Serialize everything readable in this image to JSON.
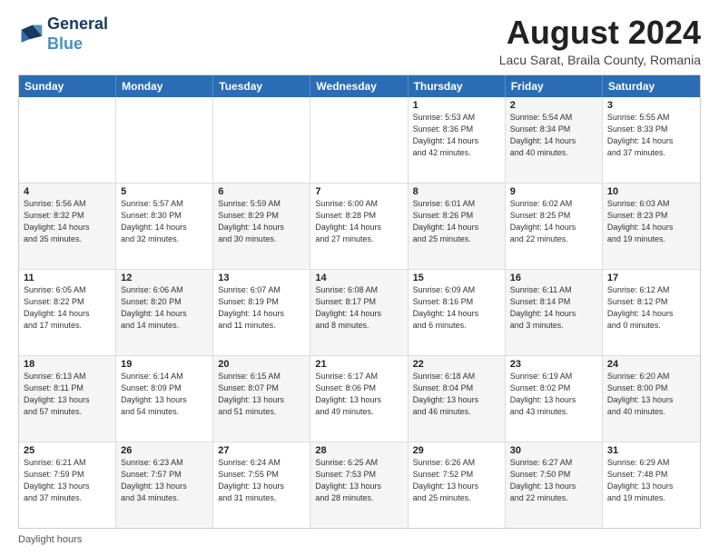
{
  "header": {
    "logo_line1": "General",
    "logo_line2": "Blue",
    "main_title": "August 2024",
    "subtitle": "Lacu Sarat, Braila County, Romania"
  },
  "days_of_week": [
    "Sunday",
    "Monday",
    "Tuesday",
    "Wednesday",
    "Thursday",
    "Friday",
    "Saturday"
  ],
  "footer_text": "Daylight hours",
  "weeks": [
    [
      {
        "day": "",
        "shaded": false,
        "info": ""
      },
      {
        "day": "",
        "shaded": false,
        "info": ""
      },
      {
        "day": "",
        "shaded": false,
        "info": ""
      },
      {
        "day": "",
        "shaded": false,
        "info": ""
      },
      {
        "day": "1",
        "shaded": false,
        "info": "Sunrise: 5:53 AM\nSunset: 8:36 PM\nDaylight: 14 hours\nand 42 minutes."
      },
      {
        "day": "2",
        "shaded": true,
        "info": "Sunrise: 5:54 AM\nSunset: 8:34 PM\nDaylight: 14 hours\nand 40 minutes."
      },
      {
        "day": "3",
        "shaded": false,
        "info": "Sunrise: 5:55 AM\nSunset: 8:33 PM\nDaylight: 14 hours\nand 37 minutes."
      }
    ],
    [
      {
        "day": "4",
        "shaded": true,
        "info": "Sunrise: 5:56 AM\nSunset: 8:32 PM\nDaylight: 14 hours\nand 35 minutes."
      },
      {
        "day": "5",
        "shaded": false,
        "info": "Sunrise: 5:57 AM\nSunset: 8:30 PM\nDaylight: 14 hours\nand 32 minutes."
      },
      {
        "day": "6",
        "shaded": true,
        "info": "Sunrise: 5:59 AM\nSunset: 8:29 PM\nDaylight: 14 hours\nand 30 minutes."
      },
      {
        "day": "7",
        "shaded": false,
        "info": "Sunrise: 6:00 AM\nSunset: 8:28 PM\nDaylight: 14 hours\nand 27 minutes."
      },
      {
        "day": "8",
        "shaded": true,
        "info": "Sunrise: 6:01 AM\nSunset: 8:26 PM\nDaylight: 14 hours\nand 25 minutes."
      },
      {
        "day": "9",
        "shaded": false,
        "info": "Sunrise: 6:02 AM\nSunset: 8:25 PM\nDaylight: 14 hours\nand 22 minutes."
      },
      {
        "day": "10",
        "shaded": true,
        "info": "Sunrise: 6:03 AM\nSunset: 8:23 PM\nDaylight: 14 hours\nand 19 minutes."
      }
    ],
    [
      {
        "day": "11",
        "shaded": false,
        "info": "Sunrise: 6:05 AM\nSunset: 8:22 PM\nDaylight: 14 hours\nand 17 minutes."
      },
      {
        "day": "12",
        "shaded": true,
        "info": "Sunrise: 6:06 AM\nSunset: 8:20 PM\nDaylight: 14 hours\nand 14 minutes."
      },
      {
        "day": "13",
        "shaded": false,
        "info": "Sunrise: 6:07 AM\nSunset: 8:19 PM\nDaylight: 14 hours\nand 11 minutes."
      },
      {
        "day": "14",
        "shaded": true,
        "info": "Sunrise: 6:08 AM\nSunset: 8:17 PM\nDaylight: 14 hours\nand 8 minutes."
      },
      {
        "day": "15",
        "shaded": false,
        "info": "Sunrise: 6:09 AM\nSunset: 8:16 PM\nDaylight: 14 hours\nand 6 minutes."
      },
      {
        "day": "16",
        "shaded": true,
        "info": "Sunrise: 6:11 AM\nSunset: 8:14 PM\nDaylight: 14 hours\nand 3 minutes."
      },
      {
        "day": "17",
        "shaded": false,
        "info": "Sunrise: 6:12 AM\nSunset: 8:12 PM\nDaylight: 14 hours\nand 0 minutes."
      }
    ],
    [
      {
        "day": "18",
        "shaded": true,
        "info": "Sunrise: 6:13 AM\nSunset: 8:11 PM\nDaylight: 13 hours\nand 57 minutes."
      },
      {
        "day": "19",
        "shaded": false,
        "info": "Sunrise: 6:14 AM\nSunset: 8:09 PM\nDaylight: 13 hours\nand 54 minutes."
      },
      {
        "day": "20",
        "shaded": true,
        "info": "Sunrise: 6:15 AM\nSunset: 8:07 PM\nDaylight: 13 hours\nand 51 minutes."
      },
      {
        "day": "21",
        "shaded": false,
        "info": "Sunrise: 6:17 AM\nSunset: 8:06 PM\nDaylight: 13 hours\nand 49 minutes."
      },
      {
        "day": "22",
        "shaded": true,
        "info": "Sunrise: 6:18 AM\nSunset: 8:04 PM\nDaylight: 13 hours\nand 46 minutes."
      },
      {
        "day": "23",
        "shaded": false,
        "info": "Sunrise: 6:19 AM\nSunset: 8:02 PM\nDaylight: 13 hours\nand 43 minutes."
      },
      {
        "day": "24",
        "shaded": true,
        "info": "Sunrise: 6:20 AM\nSunset: 8:00 PM\nDaylight: 13 hours\nand 40 minutes."
      }
    ],
    [
      {
        "day": "25",
        "shaded": false,
        "info": "Sunrise: 6:21 AM\nSunset: 7:59 PM\nDaylight: 13 hours\nand 37 minutes."
      },
      {
        "day": "26",
        "shaded": true,
        "info": "Sunrise: 6:23 AM\nSunset: 7:57 PM\nDaylight: 13 hours\nand 34 minutes."
      },
      {
        "day": "27",
        "shaded": false,
        "info": "Sunrise: 6:24 AM\nSunset: 7:55 PM\nDaylight: 13 hours\nand 31 minutes."
      },
      {
        "day": "28",
        "shaded": true,
        "info": "Sunrise: 6:25 AM\nSunset: 7:53 PM\nDaylight: 13 hours\nand 28 minutes."
      },
      {
        "day": "29",
        "shaded": false,
        "info": "Sunrise: 6:26 AM\nSunset: 7:52 PM\nDaylight: 13 hours\nand 25 minutes."
      },
      {
        "day": "30",
        "shaded": true,
        "info": "Sunrise: 6:27 AM\nSunset: 7:50 PM\nDaylight: 13 hours\nand 22 minutes."
      },
      {
        "day": "31",
        "shaded": false,
        "info": "Sunrise: 6:29 AM\nSunset: 7:48 PM\nDaylight: 13 hours\nand 19 minutes."
      }
    ]
  ]
}
